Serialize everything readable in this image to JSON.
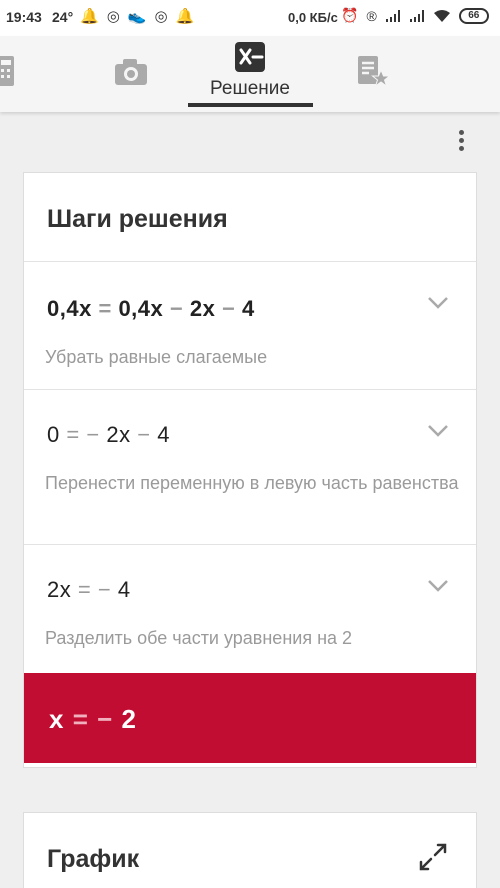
{
  "status_bar": {
    "time": "19:43",
    "temperature": "24°",
    "network_speed": "0,0 КБ/с",
    "battery": "66",
    "left_icons": [
      "notification-bell-icon",
      "chrome-icon",
      "shoe-icon",
      "chrome-icon",
      "notification-bell-icon"
    ],
    "right_icons": [
      "alarm-clock-icon",
      "registered-icon",
      "signal-icon",
      "signal-icon",
      "wifi-icon"
    ]
  },
  "tabs": [
    {
      "icon": "calculator-icon"
    },
    {
      "icon": "camera-icon"
    },
    {
      "icon": "solution-icon",
      "label": "Решение",
      "active": true
    },
    {
      "icon": "bookmarks-star-icon"
    }
  ],
  "steps_card": {
    "title": "Шаги решения",
    "steps": [
      {
        "equation_parts": [
          "0,4x",
          "=",
          "0,4x",
          "−",
          "2x",
          "−",
          "4"
        ],
        "description": "Убрать равные слагаемые"
      },
      {
        "equation_parts": [
          "0",
          "=",
          "−",
          "2x",
          "−",
          "4"
        ],
        "description": "Перенести переменную в левую часть равенства"
      },
      {
        "equation_parts": [
          "2x",
          "=",
          "−",
          "4"
        ],
        "description": "Разделить обе части уравнения на 2"
      }
    ],
    "answer_parts": [
      "x",
      "=",
      "−",
      "2"
    ]
  },
  "graph_card": {
    "title": "График"
  },
  "colors": {
    "answer_background": "#c20d32",
    "page_background": "#efefef"
  }
}
